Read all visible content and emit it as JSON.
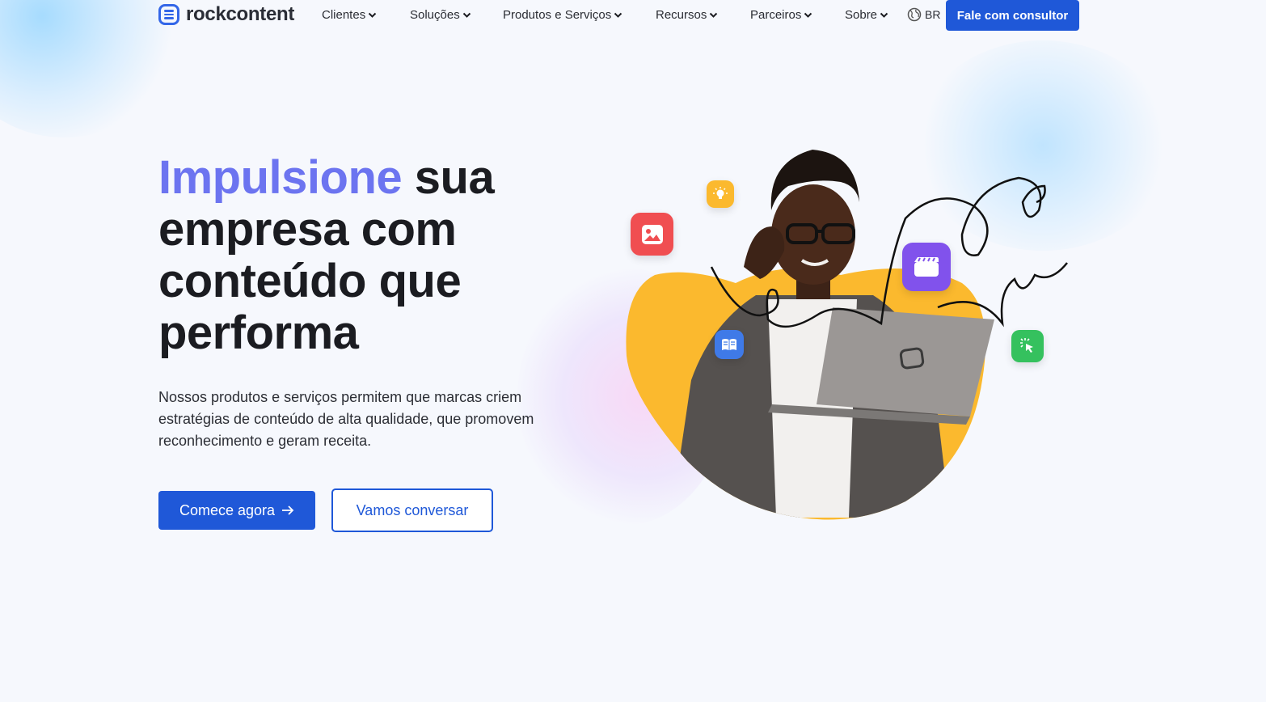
{
  "brand": {
    "name": "rockcontent",
    "accent": "#1f58d8",
    "headline_accent": "#6c74f0",
    "illustration_bg": "#fbb92e"
  },
  "nav": {
    "items": [
      {
        "label": "Clientes"
      },
      {
        "label": "Soluções"
      },
      {
        "label": "Produtos e Serviços"
      },
      {
        "label": "Recursos"
      },
      {
        "label": "Parceiros"
      },
      {
        "label": "Sobre"
      }
    ],
    "language": "BR",
    "cta_label": "Fale com consultor"
  },
  "hero": {
    "headline_accent": "Impulsione",
    "headline_part2": " sua empresa com ",
    "headline_bold": "conteúdo que performa",
    "subtitle": "Nossos produtos e serviços permitem que marcas criem estratégias de conteúdo de alta qualidade, que promovem reconhecimento e geram receita.",
    "primary_cta": "Comece agora",
    "secondary_cta": "Vamos conversar"
  },
  "illustration": {
    "icons": [
      "lightbulb-icon",
      "image-icon",
      "video-icon",
      "book-icon",
      "cursor-click-icon"
    ]
  }
}
